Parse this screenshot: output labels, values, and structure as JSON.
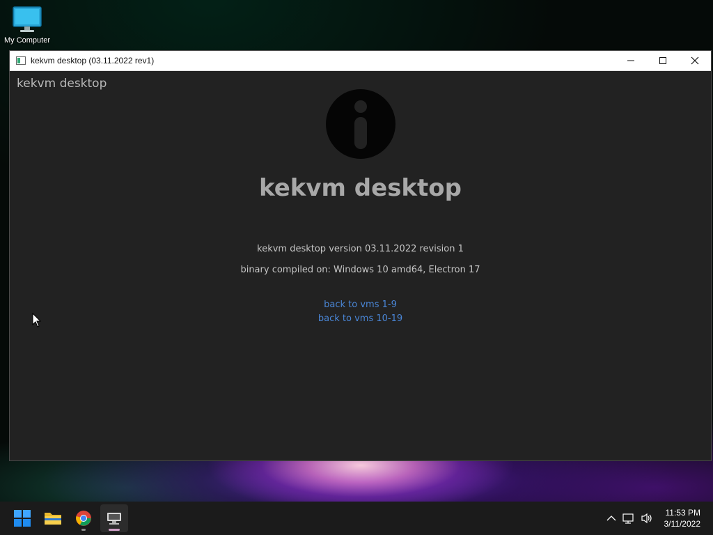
{
  "desktop": {
    "icons": [
      {
        "label": "My Computer",
        "icon": "monitor-icon"
      }
    ]
  },
  "window": {
    "title": "kekvm desktop (03.11.2022 rev1)",
    "controls": [
      "minimize-icon",
      "maximize-icon",
      "close-icon"
    ]
  },
  "app": {
    "corner_title": "kekvm desktop",
    "heading": "kekvm desktop",
    "version_text": "kekvm desktop version 03.11.2022 revision 1",
    "compiled_text": "binary compiled on: Windows 10 amd64, Electron 17",
    "links": [
      {
        "label": "back to vms 1-9"
      },
      {
        "label": "back to vms 10-19"
      }
    ],
    "info_icon": "info-icon"
  },
  "taskbar": {
    "items": [
      {
        "name": "start",
        "icon": "windows-start-icon"
      },
      {
        "name": "file-explorer",
        "icon": "folder-icon"
      },
      {
        "name": "chrome",
        "icon": "chrome-icon"
      },
      {
        "name": "kekvm-desktop",
        "icon": "kekvm-app-icon",
        "active": true
      }
    ],
    "tray_icons": [
      "chevron-up-icon",
      "network-icon",
      "volume-icon"
    ],
    "clock": {
      "time": "11:53 PM",
      "date": "3/11/2022"
    }
  },
  "colors": {
    "window_bg": "#222222",
    "link": "#4a86d6",
    "heading": "#a8a8a8",
    "taskbar": "#1b1b1b"
  }
}
